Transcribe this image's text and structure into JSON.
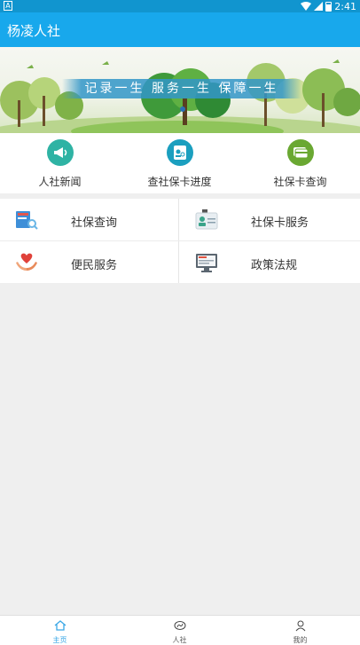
{
  "status_bar": {
    "left_icon": "A",
    "time": "2:41",
    "icons": [
      "wifi-icon",
      "signal-icon",
      "battery-icon"
    ]
  },
  "app_bar": {
    "title": "杨凌人社",
    "color": "#18a8ec"
  },
  "banner": {
    "slogan": "记录一生 服务一生 保障一生"
  },
  "quick_actions": [
    {
      "label": "人社新闻",
      "icon": "megaphone-icon",
      "color": "#2fb3a4"
    },
    {
      "label": "查社保卡进度",
      "icon": "id-card-search-icon",
      "color": "#1b9fbf"
    },
    {
      "label": "社保卡查询",
      "icon": "card-icon",
      "color": "#6aa832"
    }
  ],
  "services": [
    {
      "label": "社保查询",
      "icon": "document-search-icon"
    },
    {
      "label": "社保卡服务",
      "icon": "id-card-icon"
    },
    {
      "label": "便民服务",
      "icon": "heart-hands-icon"
    },
    {
      "label": "政策法规",
      "icon": "monitor-icon"
    }
  ],
  "tabs": [
    {
      "label": "主页",
      "icon": "home-icon",
      "active": true
    },
    {
      "label": "人社",
      "icon": "si-logo-icon",
      "active": false
    },
    {
      "label": "我的",
      "icon": "user-icon",
      "active": false
    }
  ],
  "colors": {
    "active_tab": "#3aa7e6",
    "status_bar": "#1195cf"
  }
}
